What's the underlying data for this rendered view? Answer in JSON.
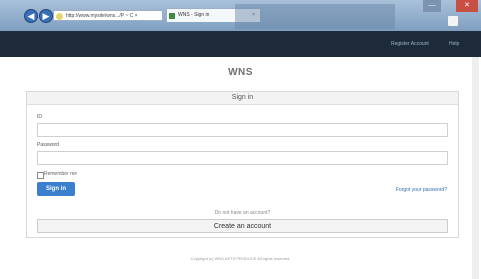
{
  "browser": {
    "back_glyph": "◀",
    "forward_glyph": "▶",
    "address": "http://www.mysite/wns.../P ~ C ×",
    "tab_title": "WNS - Sign in",
    "tab_close": "×",
    "min_glyph": "—",
    "close_glyph": "✕"
  },
  "header": {
    "register_link": "Register  Account",
    "help_link": "Help"
  },
  "app": {
    "name": "WNS"
  },
  "signin": {
    "title": "Sign in",
    "id_label": "ID",
    "id_value": "",
    "password_label": "Password",
    "password_value": "",
    "remember_label": "Remember me",
    "submit_label": "Sign in",
    "forgot_link": "Forgot your password?",
    "no_account_text": "Do not have an account?",
    "create_label": "Create an account"
  },
  "footer": {
    "text": "Copyright (c) WNS ASTS PRODUCE All rights reserved."
  },
  "colors": {
    "header_bg": "#1d2a3a",
    "primary": "#3b7fcf"
  }
}
